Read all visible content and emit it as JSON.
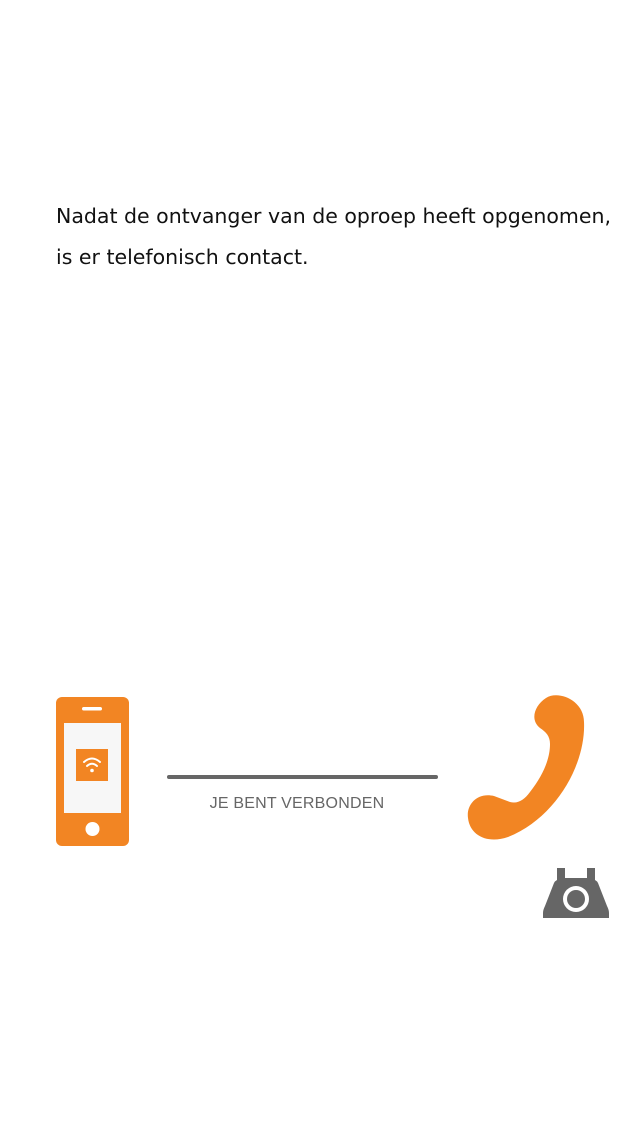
{
  "instruction": {
    "line1": "Nadat de ontvanger van de oproep heeft opgenomen,",
    "line2": "is er telefonisch contact."
  },
  "connection": {
    "status_label": "JE BENT VERBONDEN"
  },
  "icons": {
    "caller_device": "smartphone-wifi-icon",
    "receiver": "phone-handset-icon",
    "landline": "landline-phone-icon"
  },
  "colors": {
    "accent": "#F28523",
    "neutral": "#666666",
    "text": "#111111",
    "background": "#FFFFFF"
  }
}
